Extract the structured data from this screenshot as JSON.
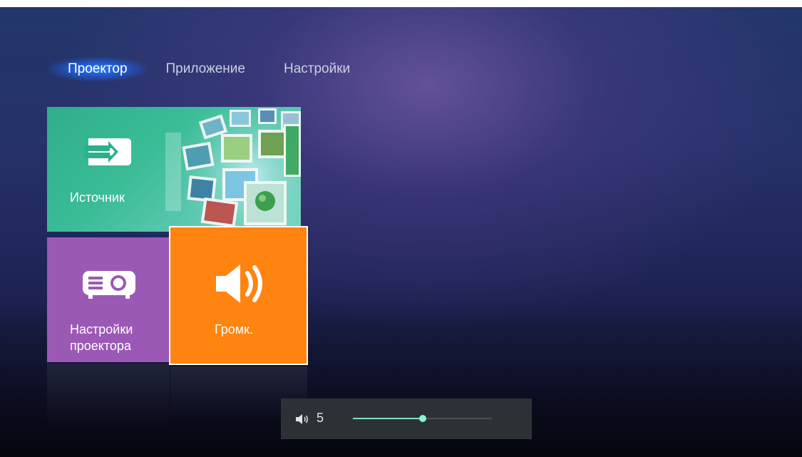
{
  "tabs": [
    {
      "label": "Проектор",
      "active": true
    },
    {
      "label": "Приложение",
      "active": false
    },
    {
      "label": "Настройки",
      "active": false
    }
  ],
  "tiles": {
    "source": {
      "label": "Источник",
      "icon": "input-source-icon",
      "color": "#2fae8c"
    },
    "projector_settings": {
      "label_line1": "Настройки",
      "label_line2": "проектора",
      "icon": "projector-icon",
      "color": "#9b59b6"
    },
    "volume": {
      "label": "Громк.",
      "icon": "speaker-icon",
      "color": "#ff8410",
      "focused": true
    }
  },
  "volume_bar": {
    "icon": "speaker-small-icon",
    "value": "5",
    "level_fraction": 0.5,
    "track_color": "#4b5257",
    "fill_color": "#7fe0c6"
  },
  "colors": {
    "active_tab_glow": "#2882ff",
    "tab_text": "#c9cfe6"
  }
}
